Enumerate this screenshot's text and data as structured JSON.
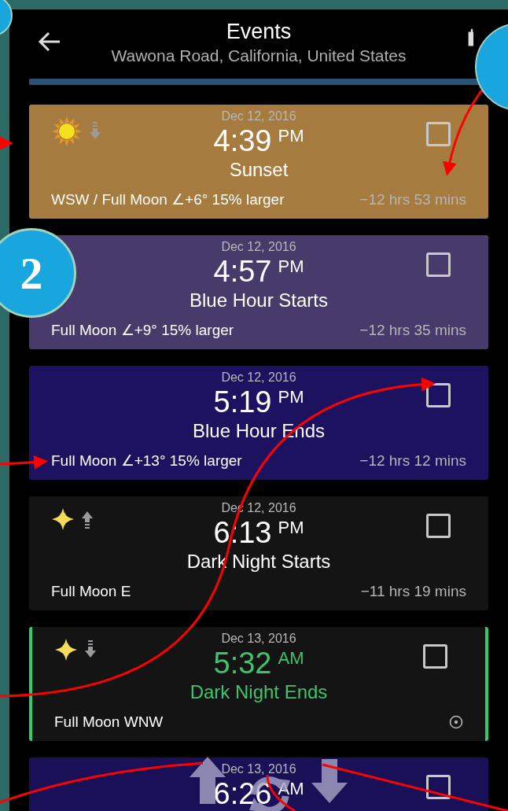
{
  "header": {
    "title": "Events",
    "subtitle": "Wawona Road, California, United States"
  },
  "progress": {
    "level": 1
  },
  "events": [
    {
      "date": "Dec 12, 2016",
      "time": "4:39",
      "ampm": "PM",
      "name": "Sunset",
      "detail": "WSW / Full Moon ∠+6° 15% larger",
      "countdown": "−12 hrs 53 mins",
      "kind": "sun",
      "rising": false,
      "color": "#a67b3f",
      "current": false,
      "checked": false
    },
    {
      "date": "Dec 12, 2016",
      "time": "4:57",
      "ampm": "PM",
      "name": "Blue Hour Starts",
      "detail": "Full Moon ∠+9° 15% larger",
      "countdown": "−12 hrs 35 mins",
      "kind": "none",
      "color": "#483b6b",
      "current": false,
      "checked": false
    },
    {
      "date": "Dec 12, 2016",
      "time": "5:19",
      "ampm": "PM",
      "name": "Blue Hour Ends",
      "detail": "Full Moon ∠+13° 15% larger",
      "countdown": "−12 hrs 12 mins",
      "kind": "none",
      "color": "#1c1260",
      "current": false,
      "checked": false
    },
    {
      "date": "Dec 12, 2016",
      "time": "6:13",
      "ampm": "PM",
      "name": "Dark Night Starts",
      "detail": "Full Moon E",
      "countdown": "−11 hrs 19 mins",
      "kind": "star",
      "rising": true,
      "color": "#141414",
      "current": false,
      "checked": false
    },
    {
      "date": "Dec 13, 2016",
      "time": "5:32",
      "ampm": "AM",
      "name": "Dark Night Ends",
      "detail": "Full Moon WNW",
      "kind": "star",
      "rising": false,
      "color": "#141414",
      "current": true,
      "checked": false
    },
    {
      "date": "Dec 13, 2016",
      "time": "6:26",
      "ampm": "AM",
      "kind": "none",
      "color": "#1a1058",
      "current": false,
      "checked": false
    }
  ],
  "annotations": [
    {
      "label": "2"
    }
  ]
}
